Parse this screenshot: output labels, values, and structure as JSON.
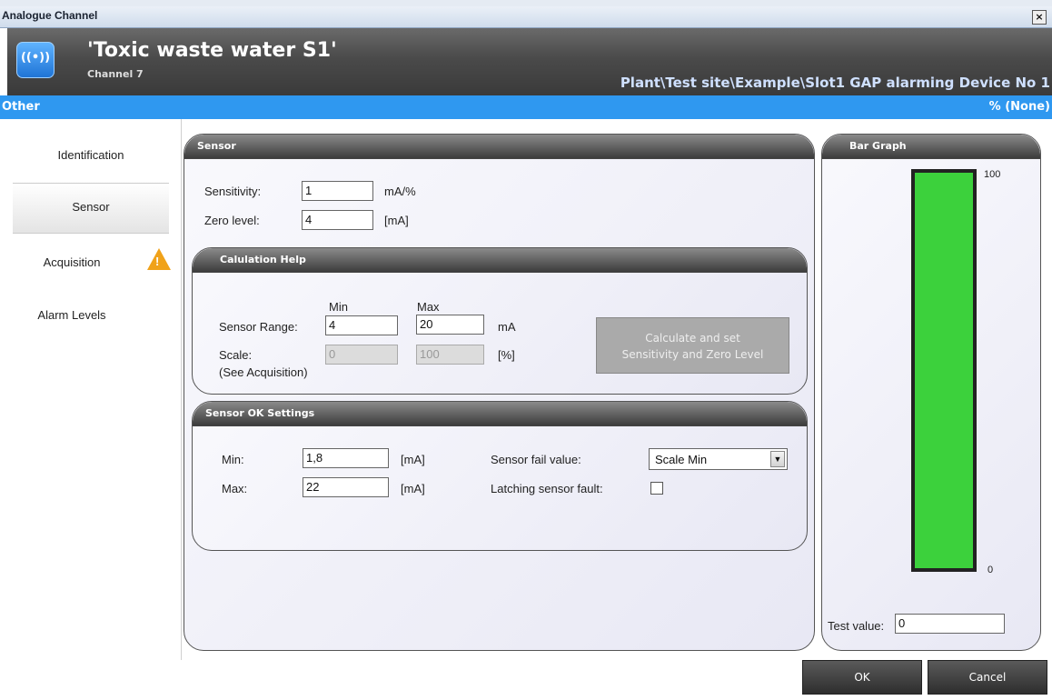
{
  "window": {
    "title": "Analogue Channel",
    "close_glyph": "×"
  },
  "header": {
    "channel_name": "'Toxic waste water S1'",
    "channel_number": "Channel 7",
    "device_path": "Plant\\Test site\\Example\\Slot1 GAP alarming Device No 1",
    "icon": "signal-wave-icon",
    "icon_glyph": "((•))"
  },
  "category_bar": {
    "left": "Other",
    "right": "% (None)"
  },
  "nav": {
    "items": [
      {
        "label": "Identification"
      },
      {
        "label": "Sensor"
      },
      {
        "label": "Acquisition"
      },
      {
        "label": "Alarm Levels"
      }
    ],
    "warning_glyph": "!"
  },
  "sensor": {
    "title": "Sensor",
    "sensitivity_label": "Sensitivity:",
    "sensitivity_value": "1",
    "sensitivity_unit": "mA/%",
    "zero_label": "Zero level:",
    "zero_value": "4",
    "zero_unit": "[mA]"
  },
  "calc_help": {
    "title": "Calulation Help",
    "min_header": "Min",
    "max_header": "Max",
    "range_label": "Sensor Range:",
    "range_min": "4",
    "range_max": "20",
    "range_unit": "mA",
    "scale_label": "Scale:",
    "scale_min": "0",
    "scale_max": "100",
    "scale_unit": "[%]",
    "scale_note": "(See Acquisition)",
    "button_line1": "Calculate and set",
    "button_line2": "Sensitivity and Zero Level"
  },
  "sensor_ok": {
    "title": "Sensor OK Settings",
    "min_label": "Min:",
    "min_value": "1,8",
    "min_unit": "[mA]",
    "max_label": "Max:",
    "max_value": "22",
    "max_unit": "[mA]",
    "fail_label": "Sensor fail value:",
    "fail_value": "Scale Min",
    "latching_label": "Latching sensor fault:",
    "latching_checked": false
  },
  "bar_graph": {
    "title": "Bar Graph",
    "max_label": "100",
    "min_label": "0",
    "fill_fraction": 1.0,
    "fill_color": "#3cd13c",
    "test_value_label": "Test value:",
    "test_value": "0"
  },
  "buttons": {
    "ok": "OK",
    "cancel": "Cancel"
  }
}
